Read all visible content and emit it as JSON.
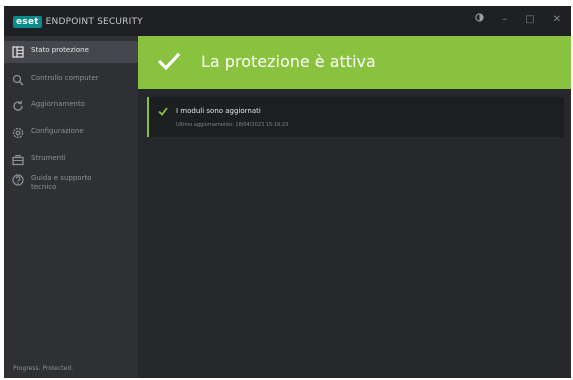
{
  "app": {
    "logo_brand": "eset",
    "logo_product": "ENDPOINT SECURITY",
    "window_controls": {
      "theme_icon": "half-circle-icon",
      "minimize": "–",
      "maximize": "□",
      "close": "✕"
    }
  },
  "sidebar": {
    "items": [
      {
        "label": "Stato protezione",
        "icon": "status-grid-icon",
        "active": true
      },
      {
        "label": "Controllo computer",
        "icon": "search-icon",
        "active": false
      },
      {
        "label": "Aggiornamento",
        "icon": "refresh-icon",
        "active": false
      },
      {
        "label": "Configurazione",
        "icon": "settings-icon",
        "active": false
      },
      {
        "label": "Strumenti",
        "icon": "briefcase-icon",
        "active": false
      },
      {
        "label": "Guida e supporto\ntecnico",
        "icon": "help-icon",
        "active": false
      }
    ],
    "footer": "Progress. Protected."
  },
  "banner": {
    "title": "La protezione è attiva",
    "color": "#88c23f"
  },
  "modules": {
    "title": "I moduli sono aggiornati",
    "subtitle": "Ultimo aggiornamento: 18/04/2023 15:19:23"
  },
  "colors": {
    "accent_green": "#88c23f",
    "brand_teal": "#0b8a8a",
    "sidebar_bg": "#2e3034",
    "content_bg": "#27282b"
  }
}
